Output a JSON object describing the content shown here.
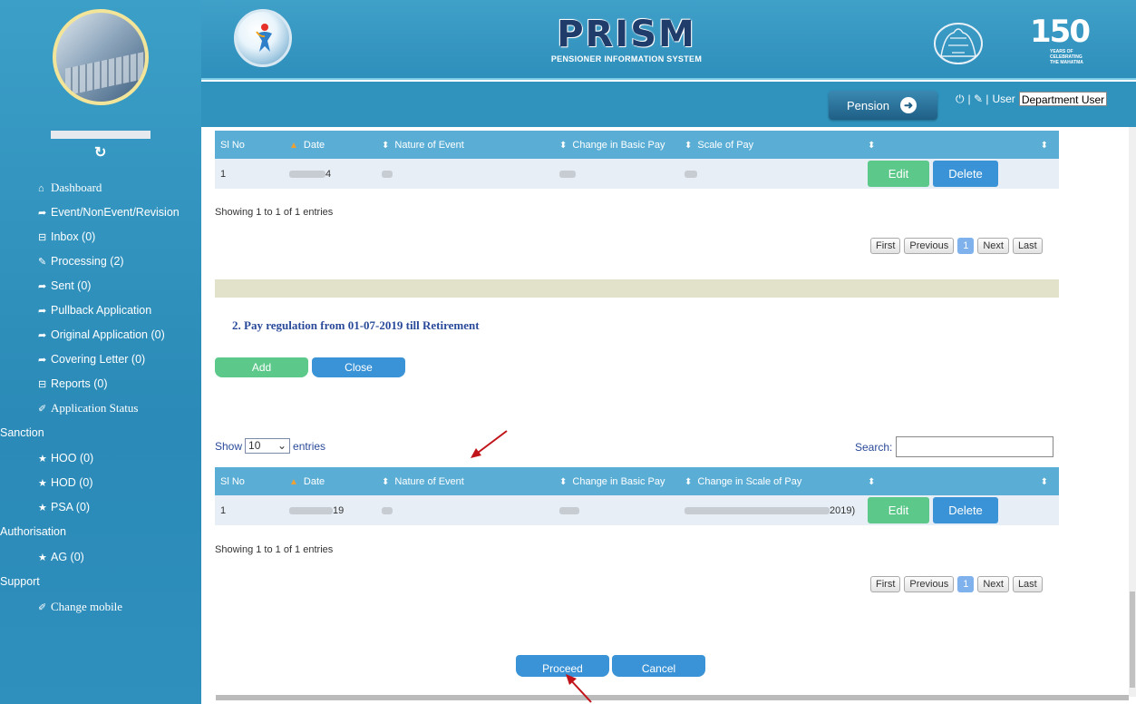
{
  "header": {
    "brand_title": "PRISM",
    "brand_subtitle": "PENSIONER INFORMATION SYSTEM",
    "anniversary_number": "150",
    "anniversary_text": "YEARS OF CELEBRATING THE MAHATMA",
    "pension_button": "Pension",
    "user_separator": "| ✎ |",
    "user_label": "User",
    "user_selected": "Department User"
  },
  "sidebar": {
    "items": [
      {
        "label": "Dashboard",
        "icon": "home-icon"
      },
      {
        "label": "Event/NonEvent/Revision",
        "icon": "share-icon"
      },
      {
        "label": "Inbox (0)",
        "icon": "inbox-icon"
      },
      {
        "label": "Processing (2)",
        "icon": "edit-icon"
      },
      {
        "label": "Sent (0)",
        "icon": "share-icon"
      },
      {
        "label": "Pullback Application",
        "icon": "share-icon"
      },
      {
        "label": "Original Application (0)",
        "icon": "share-icon"
      },
      {
        "label": "Covering Letter (0)",
        "icon": "share-icon"
      },
      {
        "label": "Reports (0)",
        "icon": "inbox-icon"
      },
      {
        "label": "Application Status",
        "icon": "pencil-icon"
      }
    ],
    "sanction_title": "Sanction",
    "sanction_items": [
      {
        "label": "HOO (0)",
        "icon": "star-icon"
      },
      {
        "label": "HOD (0)",
        "icon": "star-icon"
      },
      {
        "label": "PSA (0)",
        "icon": "star-icon"
      }
    ],
    "authorisation_title": "Authorisation",
    "authorisation_items": [
      {
        "label": "AG (0)",
        "icon": "star-icon"
      }
    ],
    "support_title": "Support",
    "support_items": [
      {
        "label": "Change mobile",
        "icon": "pencil-icon"
      }
    ]
  },
  "table1": {
    "headers": [
      "Sl No",
      "Date",
      "Nature of Event",
      "Change in Basic Pay",
      "Scale of Pay",
      "",
      ""
    ],
    "row": {
      "sl": "1",
      "date_tail": "4",
      "basic_tail": "",
      "scale_tail": "",
      "edit": "Edit",
      "delete": "Delete"
    },
    "info": "Showing 1 to 1 of 1 entries"
  },
  "pager": {
    "first": "First",
    "previous": "Previous",
    "current": "1",
    "next": "Next",
    "last": "Last"
  },
  "section2": {
    "title": "2. Pay regulation from 01-07-2019 till Retirement",
    "add": "Add",
    "close": "Close"
  },
  "table2_controls": {
    "show": "Show",
    "entries_value": "10",
    "entries": "entries",
    "search_label": "Search:"
  },
  "table2": {
    "headers": [
      "Sl No",
      "Date",
      "Nature of Event",
      "Change in Basic Pay",
      "Change in Scale of Pay",
      "",
      ""
    ],
    "row": {
      "sl": "1",
      "date_tail": "19",
      "scale_tail": "2019)",
      "edit": "Edit",
      "delete": "Delete"
    },
    "info": "Showing 1 to 1 of 1 entries"
  },
  "footer_buttons": {
    "proceed": "Proceed",
    "cancel": "Cancel"
  },
  "colors": {
    "accent": "#2f93bd",
    "edit_green": "#5cc98a",
    "delete_blue": "#3a93d6",
    "annotation_red": "#c0141a"
  }
}
